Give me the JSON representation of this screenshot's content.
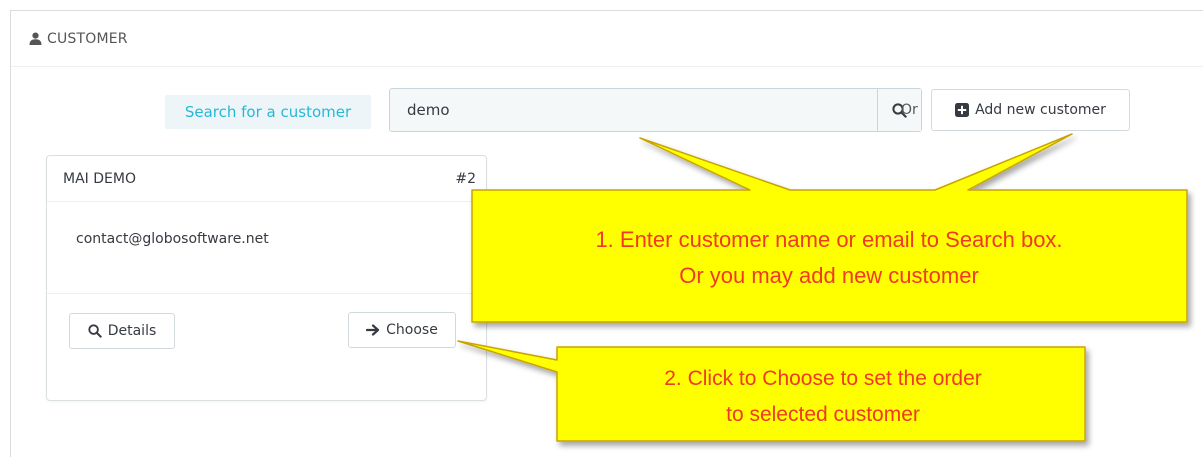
{
  "panel": {
    "title": "CUSTOMER",
    "icon": "user-icon"
  },
  "search": {
    "label": "Search for a customer",
    "value": "demo",
    "button_icon": "search-icon"
  },
  "or_text": "Or",
  "add_customer": {
    "label": "Add new customer",
    "icon": "plus-square-icon"
  },
  "customer_card": {
    "name": "MAI DEMO",
    "id": "#2",
    "email": "contact@globosoftware.net",
    "details_label": "Details",
    "details_icon": "search-icon",
    "choose_label": "Choose",
    "choose_icon": "arrow-right-icon"
  },
  "callouts": {
    "step1_line1": "1. Enter customer name or email to Search box.",
    "step1_line2": "Or you may add new customer",
    "step2_line1": "2. Click to Choose to set the order",
    "step2_line2": "to selected customer",
    "fill_color": "#ffff00",
    "text_color": "#f03a24"
  }
}
